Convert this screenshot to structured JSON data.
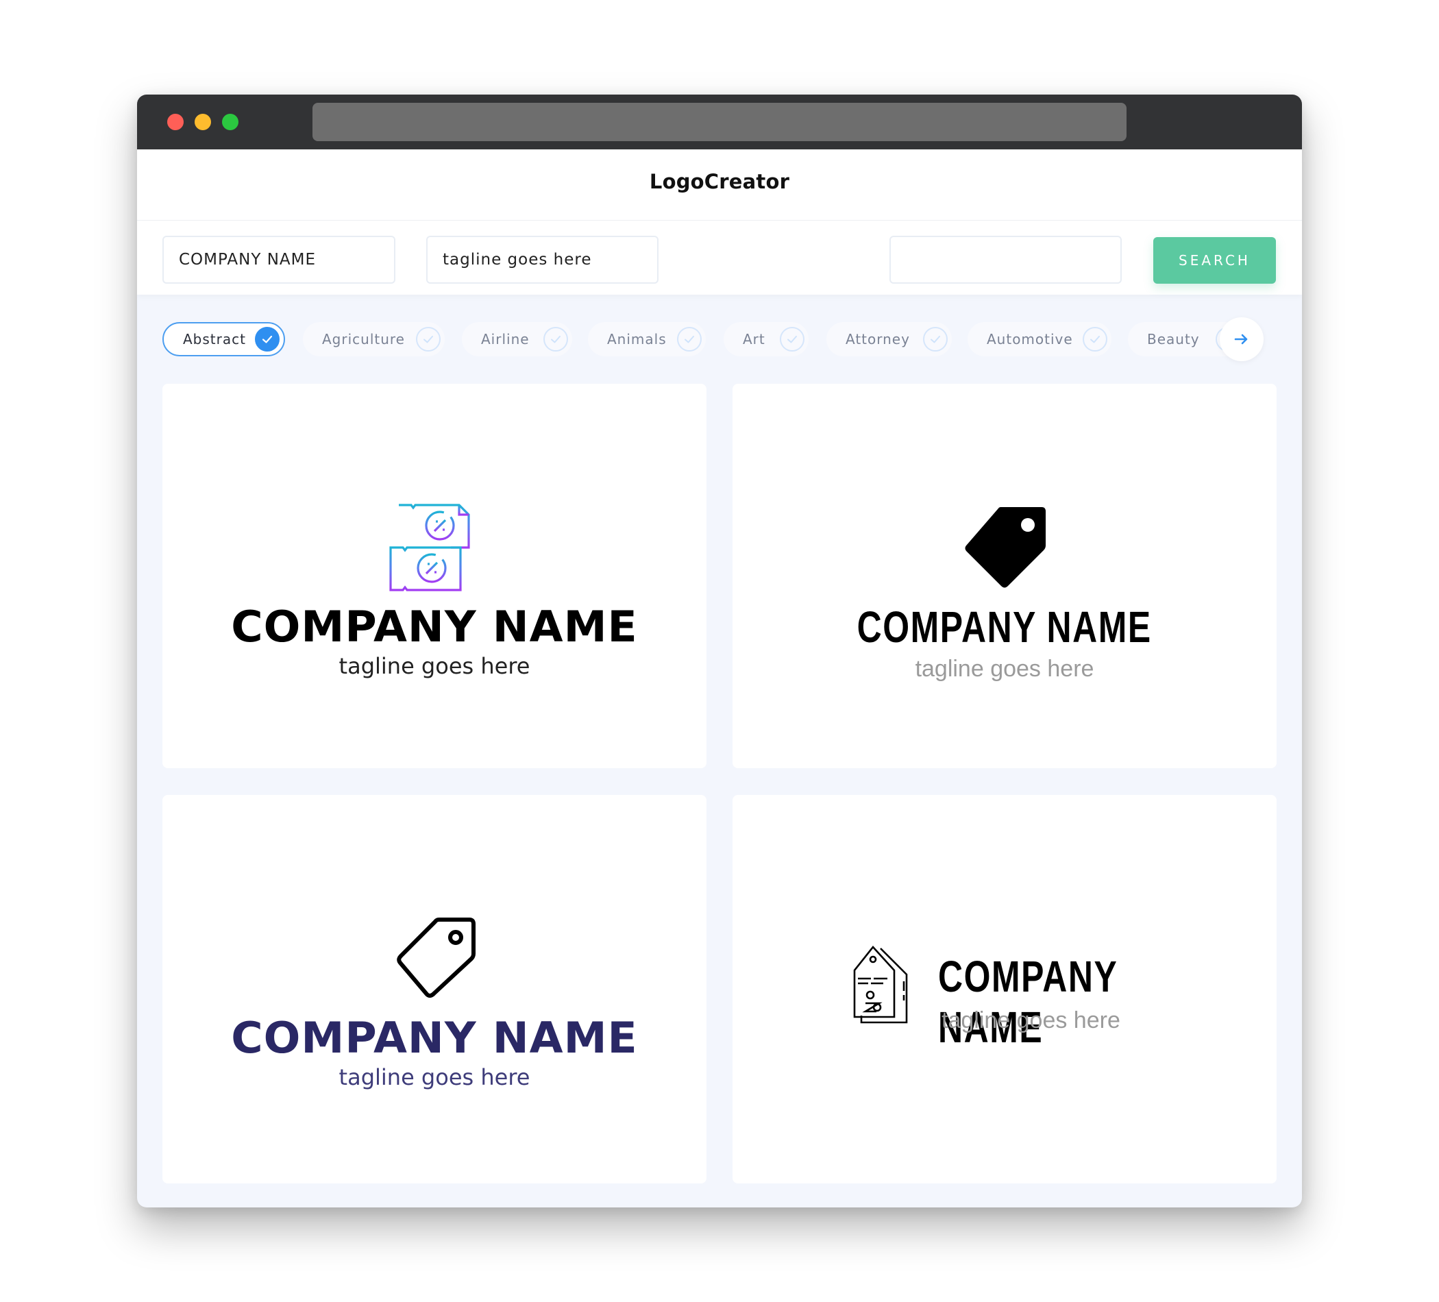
{
  "app": {
    "title": "LogoCreator"
  },
  "search": {
    "company_value": "COMPANY NAME",
    "tagline_value": "tagline goes here",
    "extra_value": "",
    "button_label": "SEARCH"
  },
  "categories": [
    {
      "label": "Abstract",
      "selected": true
    },
    {
      "label": "Agriculture",
      "selected": false
    },
    {
      "label": "Airline",
      "selected": false
    },
    {
      "label": "Animals",
      "selected": false
    },
    {
      "label": "Art",
      "selected": false
    },
    {
      "label": "Attorney",
      "selected": false
    },
    {
      "label": "Automotive",
      "selected": false
    },
    {
      "label": "Beauty",
      "selected": false
    }
  ],
  "colors": {
    "accent": "#2f8ff0",
    "search_button": "#5bc9a0",
    "navy_text": "#2a2865",
    "titlebar": "#323335",
    "page_bg": "#f3f6fd"
  },
  "logos": [
    {
      "icon": "discount-coupons-icon",
      "company_name": "COMPANY NAME",
      "tagline": "tagline goes here",
      "style": "gradient-outline"
    },
    {
      "icon": "price-tag-solid-icon",
      "company_name": "COMPANY NAME",
      "tagline": "tagline goes here",
      "style": "solid"
    },
    {
      "icon": "price-tag-outline-icon",
      "company_name": "COMPANY NAME",
      "tagline": "tagline goes here",
      "style": "outline-navy"
    },
    {
      "icon": "discount-tags-icon",
      "company_name": "COMPANY NAME",
      "tagline": "tagline goes here",
      "style": "line-horizontal"
    }
  ]
}
